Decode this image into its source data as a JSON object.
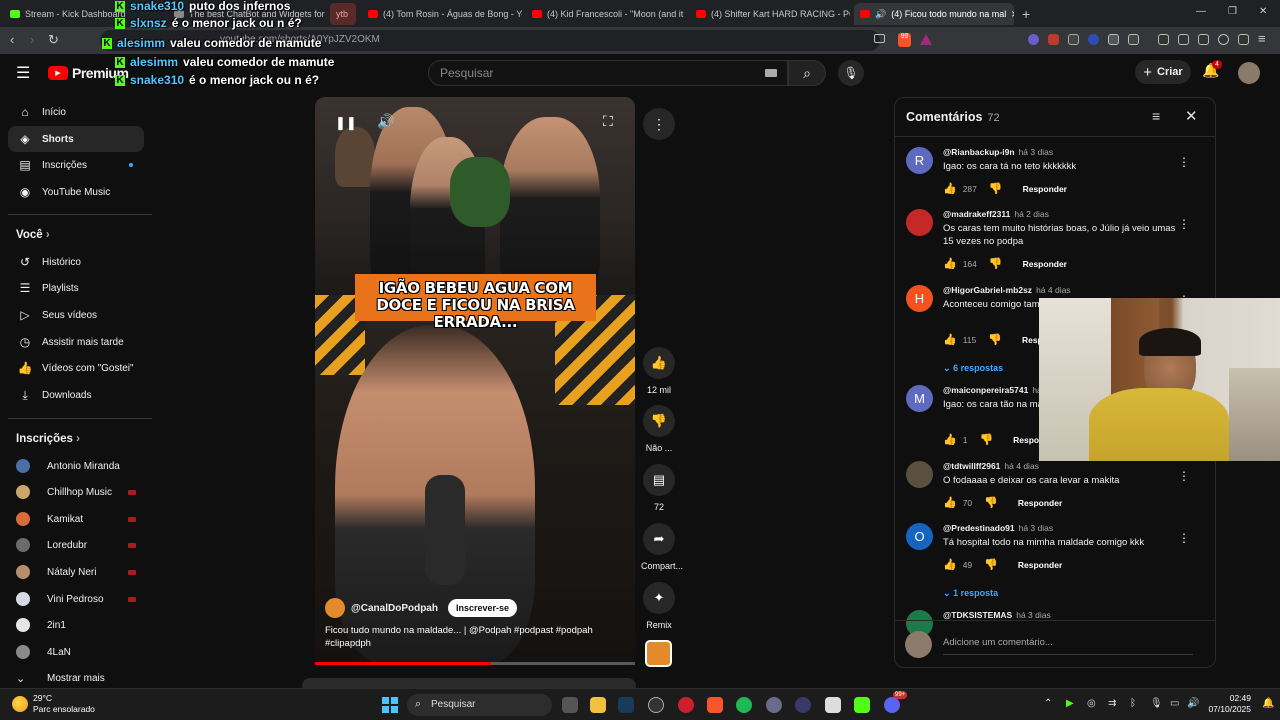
{
  "browser": {
    "tabs": [
      {
        "label": "Stream - Kick Dashboard",
        "icon": "kick-icon"
      },
      {
        "label": "The best ChatBot and Widgets for Ki",
        "icon": "bot-icon"
      },
      {
        "label": "ytb",
        "icon": "group-icon"
      },
      {
        "label": "(4) Tom Rosin - Águas de Bong - You",
        "icon": "youtube-icon"
      },
      {
        "label": "(4) Kid Francescoli - \"Moon (and it w",
        "icon": "youtube-icon"
      },
      {
        "label": "(4) Shifter Kart HARD RACING - POV",
        "icon": "youtube-icon"
      },
      {
        "label": "(4) Ficou todo mundo na mal",
        "icon": "youtube-icon"
      }
    ],
    "url": "youtube.com/shorts/A0YpJZV2OKM",
    "new_tab": "+",
    "close_tab": "×",
    "brave_badge": "99"
  },
  "youtube": {
    "logo_text": "Premium",
    "search_placeholder": "Pesquisar",
    "create_label": "Criar",
    "notif_count": "4",
    "sidebar": {
      "main": [
        {
          "label": "Início",
          "icon": "home-icon"
        },
        {
          "label": "Shorts",
          "icon": "shorts-icon",
          "active": true
        },
        {
          "label": "Inscrições",
          "icon": "subscriptions-icon"
        },
        {
          "label": "YouTube Music",
          "icon": "music-icon"
        }
      ],
      "you_heading": "Você",
      "you_items": [
        {
          "label": "Histórico",
          "icon": "history-icon"
        },
        {
          "label": "Playlists",
          "icon": "playlist-icon"
        },
        {
          "label": "Seus vídeos",
          "icon": "video-icon"
        },
        {
          "label": "Assistir mais tarde",
          "icon": "clock-icon"
        },
        {
          "label": "Vídeos com \"Gostei\"",
          "icon": "like-icon"
        },
        {
          "label": "Downloads",
          "icon": "download-icon"
        }
      ],
      "subs_heading": "Inscrições",
      "subs": [
        {
          "label": "Antonio Miranda",
          "color": "#4a6fa5",
          "live": false
        },
        {
          "label": "Chillhop Music",
          "color": "#c9a66b",
          "live": true
        },
        {
          "label": "Kamikat",
          "color": "#d96b3a",
          "live": true
        },
        {
          "label": "Loredubr",
          "color": "#6b6b6b",
          "live": true
        },
        {
          "label": "Nátaly Neri",
          "color": "#b58f6b",
          "live": true
        },
        {
          "label": "Vini Pedroso",
          "color": "#d9d9e6",
          "live": true
        },
        {
          "label": "2in1",
          "color": "#e6e6e6",
          "live": false
        },
        {
          "label": "4LaN",
          "color": "#8a8a8a",
          "live": false
        }
      ],
      "show_more": "Mostrar mais"
    },
    "short": {
      "caption": "IGÃO BEBEU AGUA COM DOCE E FICOU NA BRISA ERRADA...",
      "channel": "@CanalDoPodpah",
      "subscribe": "Inscrever-se",
      "title": "Ficou tudo mundo na maldade... | @Podpah #podpast #podpah #clipapdph",
      "progress": 0.55
    },
    "actions": [
      {
        "label": "12 mil",
        "icon": "like-icon"
      },
      {
        "label": "Não ...",
        "icon": "dislike-icon"
      },
      {
        "label": "72",
        "icon": "comment-icon"
      },
      {
        "label": "Compart...",
        "icon": "share-icon"
      },
      {
        "label": "Remix",
        "icon": "remix-icon"
      }
    ],
    "comments": {
      "title": "Comentários",
      "count": "72",
      "items": [
        {
          "initial": "R",
          "color": "#5c6bc0",
          "user": "@Rianbackup-i9n",
          "ago": "há 3 dias",
          "text": "Igao: os cara tá no teto kkkkkkk",
          "likes": "287",
          "reply": "Responder"
        },
        {
          "initial": "",
          "color": "#c62828",
          "user": "@madrakeff2311",
          "ago": "há 2 dias",
          "text": "Os caras tem muito histórias boas, o Júlio já veio umas 15 vezes no podpa",
          "likes": "164",
          "reply": "Responder"
        },
        {
          "initial": "H",
          "color": "#f4511e",
          "user": "@HigorGabriel-mb2sz",
          "ago": "há 4 dias",
          "text": "Aconteceu comigo tam... , pior sensação da vida",
          "likes": "115",
          "reply": "Responder",
          "replies": "6 respostas"
        },
        {
          "initial": "M",
          "color": "#5c6bc0",
          "user": "@maiconpereira5741",
          "ago": "há...",
          "text": "Igao: os cara tão na ma... minha makita kakakaka",
          "likes": "1",
          "reply": "Responder"
        },
        {
          "initial": "",
          "color": "#5a5040",
          "user": "@tdtwillff2961",
          "ago": "há 4 dias",
          "text": "O fodaaaa e deixar os cara levar a makita",
          "likes": "70",
          "reply": "Responder"
        },
        {
          "initial": "O",
          "color": "#1565c0",
          "user": "@Predestinado91",
          "ago": "há 3 dias",
          "text": "Tá hospital todo na mimha maldade comigo  kkk",
          "likes": "49",
          "reply": "Responder",
          "replies": "1 resposta"
        },
        {
          "initial": "",
          "color": "#1b7a4a",
          "user": "@TDKSISTEMAS",
          "ago": "há 3 dias",
          "text": "",
          "likes": "",
          "reply": ""
        }
      ],
      "add_placeholder": "Adicione um comentário..."
    }
  },
  "chat_overlay": [
    {
      "user": "snake310",
      "msg": "puto dos infernos"
    },
    {
      "user": "slxnsz",
      "msg": "é o menor jack ou n é?"
    },
    {
      "user": "alesimm",
      "msg": "valeu comedor de mamute"
    },
    {
      "user": "alesimm",
      "msg": "valeu comedor de mamute"
    },
    {
      "user": "snake310",
      "msg": "é o menor jack ou n é?"
    }
  ],
  "taskbar": {
    "temp": "29°C",
    "weather": "Parc ensolarado",
    "search": "Pesquisar",
    "time": "02:49",
    "date": "07/10/2025",
    "discord_badge": "99+"
  }
}
